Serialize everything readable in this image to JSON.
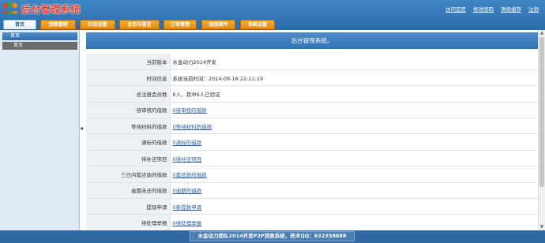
{
  "brand": {
    "title": "后台管理系统"
  },
  "top_links": [
    "访问首页",
    "修改密码",
    "清除缓存",
    "注销"
  ],
  "nav": {
    "tabs": [
      {
        "label": "首页",
        "active": true
      },
      {
        "label": "贷款管理"
      },
      {
        "label": "栏目设置"
      },
      {
        "label": "会员与留言"
      },
      {
        "label": "订单管理"
      },
      {
        "label": "短信邮件"
      },
      {
        "label": "系统设置"
      }
    ]
  },
  "sidebar": {
    "header": "首页",
    "items": [
      "首页"
    ]
  },
  "main": {
    "title": "后台管理系统。",
    "rows": [
      {
        "label": "当前版本",
        "value": "水金动力2014开发",
        "link": false
      },
      {
        "label": "时间信息",
        "value": "系统当前时间：2014-09-18 22:11:19",
        "link": false
      },
      {
        "label": "总注册会员数",
        "value": "6人，其中6人已验证",
        "link": false
      },
      {
        "label": "待审核的借款",
        "value": "0待审核的借款",
        "link": true
      },
      {
        "label": "等待材料的借款",
        "value": "0等待材料的借款",
        "link": true
      },
      {
        "label": "满标的借款",
        "value": "0满标的借款",
        "link": true
      },
      {
        "label": "待补还项目",
        "value": "0待补还项目",
        "link": true
      },
      {
        "label": "三日内需还款的借款",
        "value": "0需还款的借款",
        "link": true
      },
      {
        "label": "逾期未还的借款",
        "value": "0逾期的借款",
        "link": true
      },
      {
        "label": "提现申请",
        "value": "0新提款申请",
        "link": true
      },
      {
        "label": "待处理举报",
        "value": "0待处理举报",
        "link": true
      }
    ]
  },
  "footer": {
    "text": "水金动力团队2014开发P2P贷款系统，技术QQ：632358888"
  },
  "colors": {
    "header_blue": "#3f87c4",
    "tab_orange": "#e0870c",
    "logo_red": "#f23a2a",
    "link_blue": "#2a5fa3"
  }
}
